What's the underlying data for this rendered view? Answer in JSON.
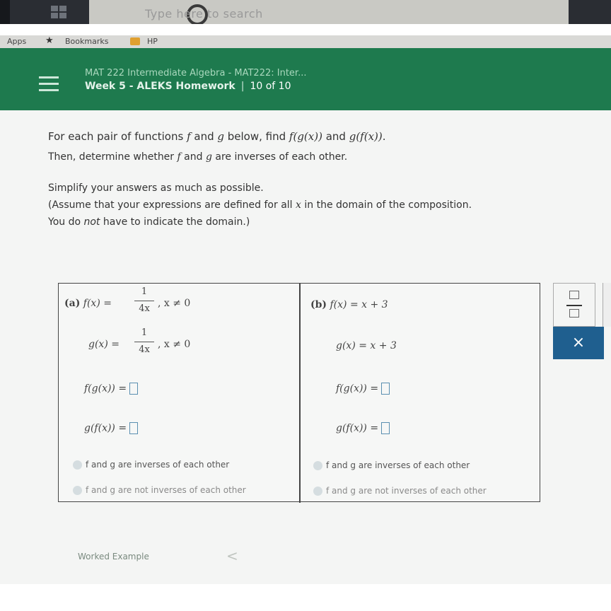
{
  "taskbar": {
    "search_placeholder": "Type here to search"
  },
  "bookmarks": {
    "apps": "Apps",
    "bookmarks": "Bookmarks",
    "hp": "HP"
  },
  "header": {
    "course_title": "MAT 222 Intermediate Algebra - MAT222: Inter...",
    "assignment": "Week 5 - ALEKS Homework",
    "counter": "10 of 10"
  },
  "instructions": {
    "line1_a": "For each pair of functions ",
    "line1_f": "f",
    "line1_b": " and ",
    "line1_g": "g",
    "line1_c": " below, find ",
    "line1_fg": "f(g(x))",
    "line1_d": " and ",
    "line1_gf": "g(f(x))",
    "line1_e": ".",
    "line2_a": "Then, determine whether ",
    "line2_f": "f",
    "line2_b": " and ",
    "line2_g": "g",
    "line2_c": " are inverses of each other.",
    "line3": "Simplify your answers as much as possible.",
    "line4_a": "(Assume that your expressions are defined for all ",
    "line4_x": "x",
    "line4_b": " in the domain of the composition.",
    "line5_a": "You do ",
    "line5_not": "not",
    "line5_b": " have to indicate the domain.)"
  },
  "part_a": {
    "label": "(a)",
    "f_def": "f(x) =",
    "f_num": "1",
    "f_den": "4x",
    "f_cond": ", x ≠ 0",
    "g_def": "g(x) =",
    "g_num": "1",
    "g_den": "4x",
    "g_cond": ", x ≠ 0",
    "fg_label": "f(g(x)) =",
    "gf_label": "g(f(x)) =",
    "option_inverse": "f and g are inverses of each other",
    "option_not_inverse": "f and g are not inverses of each other"
  },
  "part_b": {
    "label": "(b)",
    "f_def": "f(x) = x + 3",
    "g_def": "g(x) = x + 3",
    "fg_label": "f(g(x)) =",
    "gf_label": "g(f(x)) =",
    "option_inverse": "f and g are inverses of each other",
    "option_not_inverse": "f and g are not inverses of each other"
  },
  "tools": {
    "clear_symbol": "×"
  },
  "footer": {
    "worked_example": "Worked Example",
    "prev_symbol": "<"
  }
}
